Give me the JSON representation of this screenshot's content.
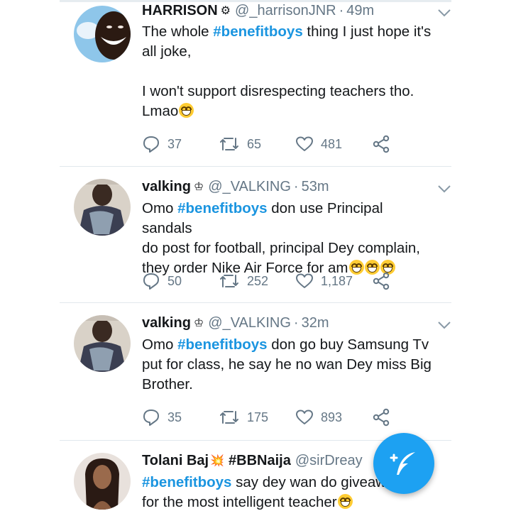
{
  "tweets": [
    {
      "name": "HARRISON",
      "badge": "⚙",
      "handle": "@_harrisonJNR",
      "time": "49m",
      "lines": [
        {
          "pre": "The whole ",
          "tag": "#benefitboys",
          "post": " thing I just hope it's"
        },
        {
          "pre": "all joke,",
          "tag": "",
          "post": ""
        },
        {
          "pre": "",
          "tag": "",
          "post": ""
        },
        {
          "pre": "I won't support disrespecting teachers tho.",
          "tag": "",
          "post": ""
        },
        {
          "pre": "Lmao",
          "tag": "",
          "post": ""
        }
      ],
      "emoji_count_last_line": 1,
      "replies": "37",
      "retweets": "65",
      "likes": "481"
    },
    {
      "name": "valking",
      "badge": "♔",
      "handle": "@_VALKING",
      "time": "53m",
      "lines": [
        {
          "pre": "Omo ",
          "tag": "#benefitboys",
          "post": " don use Principal sandals"
        },
        {
          "pre": "do post for football, principal Dey complain,",
          "tag": "",
          "post": ""
        },
        {
          "pre": "they order Nike Air Force for am",
          "tag": "",
          "post": ""
        }
      ],
      "emoji_count_last_line": 3,
      "replies": "50",
      "retweets": "252",
      "likes": "1,187"
    },
    {
      "name": "valking",
      "badge": "♔",
      "handle": "@_VALKING",
      "time": "32m",
      "lines": [
        {
          "pre": "Omo ",
          "tag": "#benefitboys",
          "post": " don go buy Samsung Tv"
        },
        {
          "pre": "put for class, he say he no wan Dey miss Big",
          "tag": "",
          "post": ""
        },
        {
          "pre": "Brother.",
          "tag": "",
          "post": ""
        }
      ],
      "emoji_count_last_line": 0,
      "replies": "35",
      "retweets": "175",
      "likes": "893"
    },
    {
      "name": "Tolani Baj",
      "badge": "💥",
      "name_suffix": "#BBNaija",
      "handle": "@sirDreay",
      "time": "",
      "lines": [
        {
          "pre": "",
          "tag": "#benefitboys",
          "post": " say dey wan do giveaw"
        },
        {
          "pre": "for the most intelligent teacher",
          "tag": "",
          "post": ""
        }
      ],
      "emoji_count_last_line": 1
    }
  ],
  "colors": {
    "accent": "#1da1f2",
    "hashtag": "#1b95e0",
    "muted": "#657786"
  },
  "icons": [
    "reply-icon",
    "retweet-icon",
    "like-icon",
    "share-icon",
    "chevron-down-icon",
    "compose-tweet-icon"
  ]
}
